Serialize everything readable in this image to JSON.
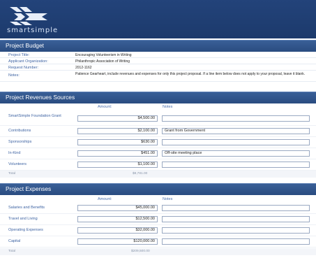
{
  "brand": {
    "name": "smartsimple"
  },
  "budget": {
    "title": "Project Budget",
    "fields": [
      {
        "label": "Project Title:",
        "value": "Encouraging Volunteerism in Writing"
      },
      {
        "label": "Applicant Organization:",
        "value": "Philanthropic Association of Writing"
      },
      {
        "label": "Request Number:",
        "value": "2012-1162"
      },
      {
        "label": "Notes:",
        "value": "Patience Gearheart, include revenues and expenses for only this project proposal. If a line item below does not apply to your proposal, leave it blank."
      }
    ]
  },
  "revenues": {
    "title": "Project Revenues Sources",
    "col_amount": "Amount:",
    "col_notes": "Notes",
    "rows": [
      {
        "label": "SmartSimple Foundation Grant",
        "amount": "$4,500.00",
        "notes": ""
      },
      {
        "label": "Contributions",
        "amount": "$2,100.00",
        "notes": "Grant from Government"
      },
      {
        "label": "Sponsorships",
        "amount": "$630.00",
        "notes": ""
      },
      {
        "label": "In-Kind",
        "amount": "$451.00",
        "notes": "Off-site meeting place"
      },
      {
        "label": "Volunteers",
        "amount": "$1,100.00",
        "notes": ""
      }
    ],
    "total_label": "Total",
    "total_value": "$8,781.00"
  },
  "expenses": {
    "title": "Project Expenses",
    "col_amount": "Amount:",
    "col_notes": "Notes",
    "rows": [
      {
        "label": "Salaries and Benefits",
        "amount": "$45,000.00",
        "notes": ""
      },
      {
        "label": "Travel and Living",
        "amount": "$12,500.00",
        "notes": ""
      },
      {
        "label": "Operating Expenses",
        "amount": "$32,000.00",
        "notes": ""
      },
      {
        "label": "Capital",
        "amount": "$120,000.00",
        "notes": ""
      }
    ],
    "total_label": "Total",
    "total_value": "$209,500.00"
  },
  "colors": {
    "banner": "#1c3a6c",
    "section_bar": "#2f5288",
    "label": "#3f64a3"
  }
}
